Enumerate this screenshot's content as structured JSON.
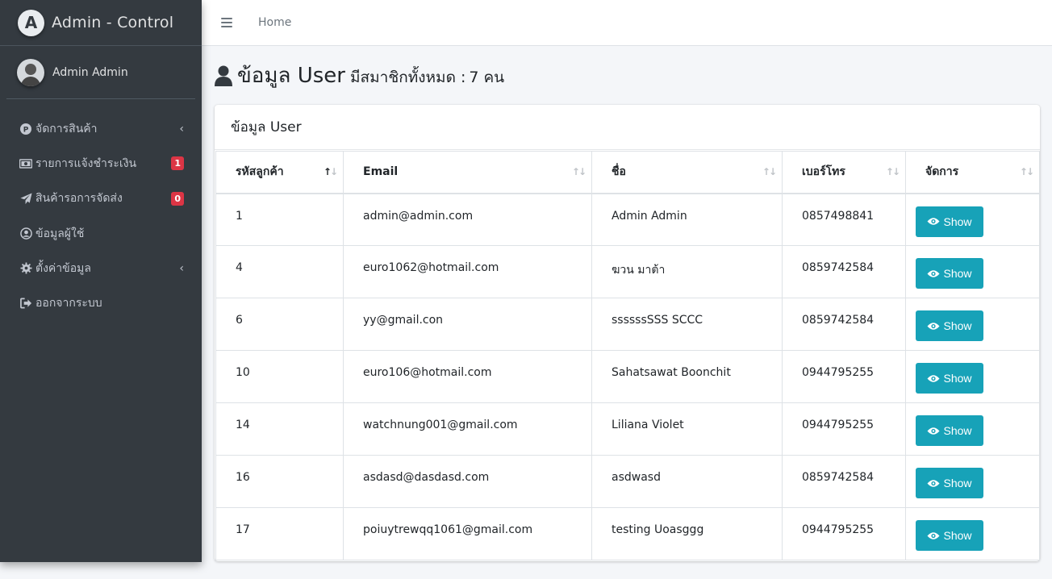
{
  "brand": {
    "letter": "A",
    "name": "Admin - Control"
  },
  "user": {
    "name": "Admin Admin"
  },
  "nav": [
    {
      "label": "จัดการสินค้า",
      "icon": "product-circle-icon",
      "chevron": "‹"
    },
    {
      "label": "รายการแจ้งชำระเงิน",
      "icon": "money-bill-icon",
      "badge": "1"
    },
    {
      "label": "สินค้ารอการจัดส่ง",
      "icon": "paper-plane-icon",
      "badge": "0"
    },
    {
      "label": "ข้อมูลผู้ใช้",
      "icon": "user-circle-icon"
    },
    {
      "label": "ตั้งค่าข้อมูล",
      "icon": "gear-icon",
      "chevron": "‹"
    },
    {
      "label": "ออกจากระบบ",
      "icon": "sign-out-icon"
    }
  ],
  "header": {
    "home": "Home"
  },
  "page": {
    "title": "ข้อมูล User",
    "subtitle": "มีสมาชิกทั้งหมด :",
    "count": "7",
    "unit": "คน"
  },
  "card": {
    "title": "ข้อมูล User"
  },
  "table": {
    "columns": [
      "รหัสลูกค้า",
      "Email",
      "ชื่อ",
      "เบอร์โทร",
      "จัดการ"
    ],
    "action_label": "Show",
    "rows": [
      {
        "id": "1",
        "email": "admin@admin.com",
        "name": "Admin Admin",
        "phone": "0857498841"
      },
      {
        "id": "4",
        "email": "euro1062@hotmail.com",
        "name": "ฆวน มาต้า",
        "phone": "0859742584"
      },
      {
        "id": "6",
        "email": "yy@gmail.con",
        "name": "ssssssSSS SCCC",
        "phone": "0859742584"
      },
      {
        "id": "10",
        "email": "euro106@hotmail.com",
        "name": "Sahatsawat Boonchit",
        "phone": "0944795255"
      },
      {
        "id": "14",
        "email": "watchnung001@gmail.com",
        "name": "Liliana Violet",
        "phone": "0944795255"
      },
      {
        "id": "16",
        "email": "asdasd@dasdasd.com",
        "name": "asdwasd",
        "phone": "0859742584"
      },
      {
        "id": "17",
        "email": "poiuytrewqq1061@gmail.com",
        "name": "testing Uoasggg",
        "phone": "0944795255"
      }
    ]
  },
  "colors": {
    "sidebar": "#343a40",
    "accent": "#17a2b8",
    "badge": "#dc3545",
    "background": "#f4f6f9"
  }
}
